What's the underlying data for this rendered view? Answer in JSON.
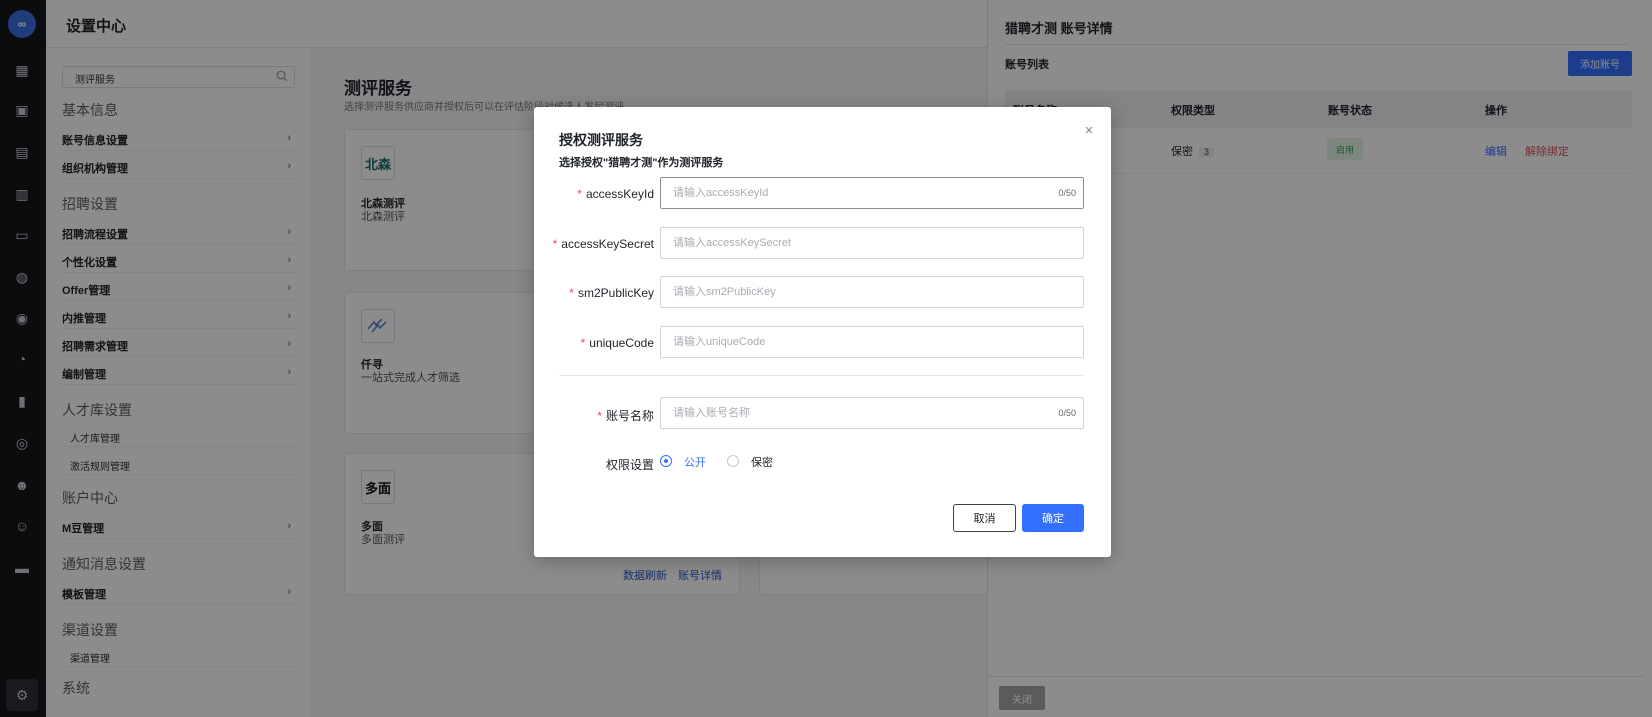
{
  "rail": {
    "logo_text": "∞",
    "icons": [
      "dashboard-icon",
      "briefcase-icon",
      "document-search-icon",
      "calendar-icon",
      "id-card-icon",
      "wechat-icon",
      "badge-icon",
      "pie-chart-icon",
      "bar-chart-icon",
      "user-circle-icon",
      "team-icon",
      "user-group-icon",
      "message-icon"
    ],
    "bottom_icon": "settings-icon"
  },
  "header": {
    "title": "设置中心"
  },
  "sidebar": {
    "search_value": "测评服务",
    "groups": [
      {
        "title": "基本信息",
        "items": [
          {
            "label": "账号信息设置"
          },
          {
            "label": "组织机构管理"
          }
        ]
      },
      {
        "title": "招聘设置",
        "items": [
          {
            "label": "招聘流程设置"
          },
          {
            "label": "个性化设置"
          },
          {
            "label": "Offer管理"
          },
          {
            "label": "内推管理"
          },
          {
            "label": "招聘需求管理"
          },
          {
            "label": "编制管理"
          }
        ]
      },
      {
        "title": "人才库设置",
        "subitems": [
          {
            "label": "人才库管理"
          },
          {
            "label": "激活规则管理"
          }
        ]
      },
      {
        "title": "账户中心",
        "items": [
          {
            "label": "M豆管理"
          }
        ]
      },
      {
        "title": "通知消息设置",
        "items": [
          {
            "label": "模板管理"
          }
        ]
      },
      {
        "title": "渠道设置",
        "subitems": [
          {
            "label": "渠道管理"
          }
        ]
      }
    ],
    "truncated_group": "系统"
  },
  "main": {
    "title": "测评服务",
    "desc": "选择测评服务供应商并授权后可以在评估阶段对候选人发起测评",
    "cards": [
      {
        "logo": "北森",
        "name": "北森测评",
        "sub": "北森测评"
      },
      {
        "logo": "",
        "name": "仟寻",
        "sub": "一站式完成人才筛选"
      },
      {
        "logo": "多面",
        "name": "多面",
        "sub": "多面测评",
        "links": [
          "数据刷新",
          "账号详情"
        ]
      }
    ]
  },
  "drawer": {
    "title": "猎聘才测 账号详情",
    "subtitle": "账号列表",
    "add_button": "添加账号",
    "columns": [
      "账号名称",
      "权限类型",
      "账号状态",
      "操作"
    ],
    "rows": [
      {
        "name": "",
        "perm": "保密",
        "perm_count": "3",
        "status": "启用",
        "actions": [
          "编辑",
          "解除绑定"
        ]
      }
    ],
    "close_button": "关闭"
  },
  "modal": {
    "title": "授权测评服务",
    "subtitle": "选择授权\"猎聘才测\"作为测评服务",
    "fields": [
      {
        "label": "accessKeyId",
        "placeholder": "请输入accessKeyId",
        "value": "",
        "counter": "0/50"
      },
      {
        "label": "accessKeySecret",
        "placeholder": "请输入accessKeySecret",
        "value": ""
      },
      {
        "label": "sm2PublicKey",
        "placeholder": "请输入sm2PublicKey",
        "value": ""
      },
      {
        "label": "uniqueCode",
        "placeholder": "请输入uniqueCode",
        "value": ""
      },
      {
        "label": "账号名称",
        "placeholder": "请输入账号名称",
        "value": "",
        "counter": "0/50"
      }
    ],
    "required_mark": "*",
    "permission": {
      "label": "权限设置",
      "options": [
        "公开",
        "保密"
      ],
      "selected": "公开"
    },
    "cancel": "取消",
    "confirm": "确定"
  },
  "colors": {
    "primary": "#3370ff",
    "danger": "#e34d59",
    "rail": "#14161a",
    "success": "#2ea44f"
  }
}
